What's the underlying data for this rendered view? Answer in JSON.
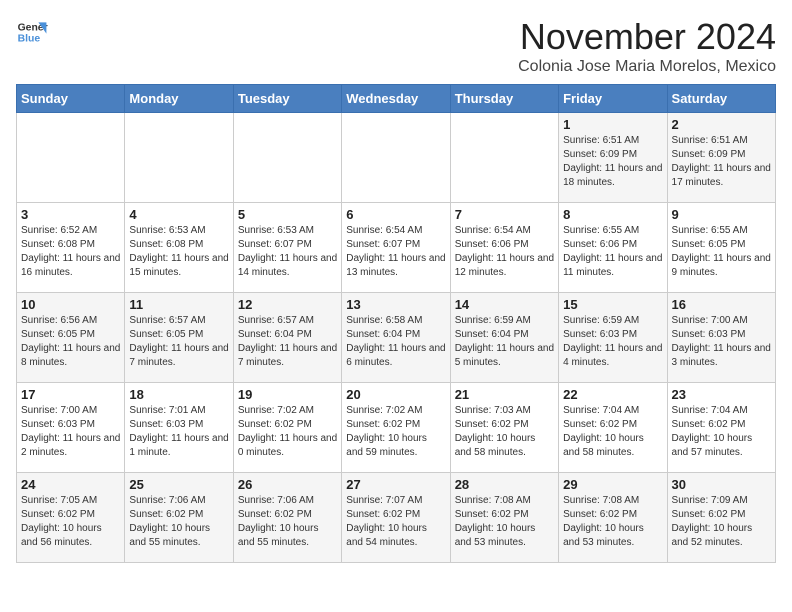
{
  "logo": {
    "line1": "General",
    "line2": "Blue"
  },
  "title": "November 2024",
  "subtitle": "Colonia Jose Maria Morelos, Mexico",
  "days_of_week": [
    "Sunday",
    "Monday",
    "Tuesday",
    "Wednesday",
    "Thursday",
    "Friday",
    "Saturday"
  ],
  "weeks": [
    [
      {
        "day": "",
        "info": ""
      },
      {
        "day": "",
        "info": ""
      },
      {
        "day": "",
        "info": ""
      },
      {
        "day": "",
        "info": ""
      },
      {
        "day": "",
        "info": ""
      },
      {
        "day": "1",
        "info": "Sunrise: 6:51 AM\nSunset: 6:09 PM\nDaylight: 11 hours and 18 minutes."
      },
      {
        "day": "2",
        "info": "Sunrise: 6:51 AM\nSunset: 6:09 PM\nDaylight: 11 hours and 17 minutes."
      }
    ],
    [
      {
        "day": "3",
        "info": "Sunrise: 6:52 AM\nSunset: 6:08 PM\nDaylight: 11 hours and 16 minutes."
      },
      {
        "day": "4",
        "info": "Sunrise: 6:53 AM\nSunset: 6:08 PM\nDaylight: 11 hours and 15 minutes."
      },
      {
        "day": "5",
        "info": "Sunrise: 6:53 AM\nSunset: 6:07 PM\nDaylight: 11 hours and 14 minutes."
      },
      {
        "day": "6",
        "info": "Sunrise: 6:54 AM\nSunset: 6:07 PM\nDaylight: 11 hours and 13 minutes."
      },
      {
        "day": "7",
        "info": "Sunrise: 6:54 AM\nSunset: 6:06 PM\nDaylight: 11 hours and 12 minutes."
      },
      {
        "day": "8",
        "info": "Sunrise: 6:55 AM\nSunset: 6:06 PM\nDaylight: 11 hours and 11 minutes."
      },
      {
        "day": "9",
        "info": "Sunrise: 6:55 AM\nSunset: 6:05 PM\nDaylight: 11 hours and 9 minutes."
      }
    ],
    [
      {
        "day": "10",
        "info": "Sunrise: 6:56 AM\nSunset: 6:05 PM\nDaylight: 11 hours and 8 minutes."
      },
      {
        "day": "11",
        "info": "Sunrise: 6:57 AM\nSunset: 6:05 PM\nDaylight: 11 hours and 7 minutes."
      },
      {
        "day": "12",
        "info": "Sunrise: 6:57 AM\nSunset: 6:04 PM\nDaylight: 11 hours and 7 minutes."
      },
      {
        "day": "13",
        "info": "Sunrise: 6:58 AM\nSunset: 6:04 PM\nDaylight: 11 hours and 6 minutes."
      },
      {
        "day": "14",
        "info": "Sunrise: 6:59 AM\nSunset: 6:04 PM\nDaylight: 11 hours and 5 minutes."
      },
      {
        "day": "15",
        "info": "Sunrise: 6:59 AM\nSunset: 6:03 PM\nDaylight: 11 hours and 4 minutes."
      },
      {
        "day": "16",
        "info": "Sunrise: 7:00 AM\nSunset: 6:03 PM\nDaylight: 11 hours and 3 minutes."
      }
    ],
    [
      {
        "day": "17",
        "info": "Sunrise: 7:00 AM\nSunset: 6:03 PM\nDaylight: 11 hours and 2 minutes."
      },
      {
        "day": "18",
        "info": "Sunrise: 7:01 AM\nSunset: 6:03 PM\nDaylight: 11 hours and 1 minute."
      },
      {
        "day": "19",
        "info": "Sunrise: 7:02 AM\nSunset: 6:02 PM\nDaylight: 11 hours and 0 minutes."
      },
      {
        "day": "20",
        "info": "Sunrise: 7:02 AM\nSunset: 6:02 PM\nDaylight: 10 hours and 59 minutes."
      },
      {
        "day": "21",
        "info": "Sunrise: 7:03 AM\nSunset: 6:02 PM\nDaylight: 10 hours and 58 minutes."
      },
      {
        "day": "22",
        "info": "Sunrise: 7:04 AM\nSunset: 6:02 PM\nDaylight: 10 hours and 58 minutes."
      },
      {
        "day": "23",
        "info": "Sunrise: 7:04 AM\nSunset: 6:02 PM\nDaylight: 10 hours and 57 minutes."
      }
    ],
    [
      {
        "day": "24",
        "info": "Sunrise: 7:05 AM\nSunset: 6:02 PM\nDaylight: 10 hours and 56 minutes."
      },
      {
        "day": "25",
        "info": "Sunrise: 7:06 AM\nSunset: 6:02 PM\nDaylight: 10 hours and 55 minutes."
      },
      {
        "day": "26",
        "info": "Sunrise: 7:06 AM\nSunset: 6:02 PM\nDaylight: 10 hours and 55 minutes."
      },
      {
        "day": "27",
        "info": "Sunrise: 7:07 AM\nSunset: 6:02 PM\nDaylight: 10 hours and 54 minutes."
      },
      {
        "day": "28",
        "info": "Sunrise: 7:08 AM\nSunset: 6:02 PM\nDaylight: 10 hours and 53 minutes."
      },
      {
        "day": "29",
        "info": "Sunrise: 7:08 AM\nSunset: 6:02 PM\nDaylight: 10 hours and 53 minutes."
      },
      {
        "day": "30",
        "info": "Sunrise: 7:09 AM\nSunset: 6:02 PM\nDaylight: 10 hours and 52 minutes."
      }
    ]
  ]
}
